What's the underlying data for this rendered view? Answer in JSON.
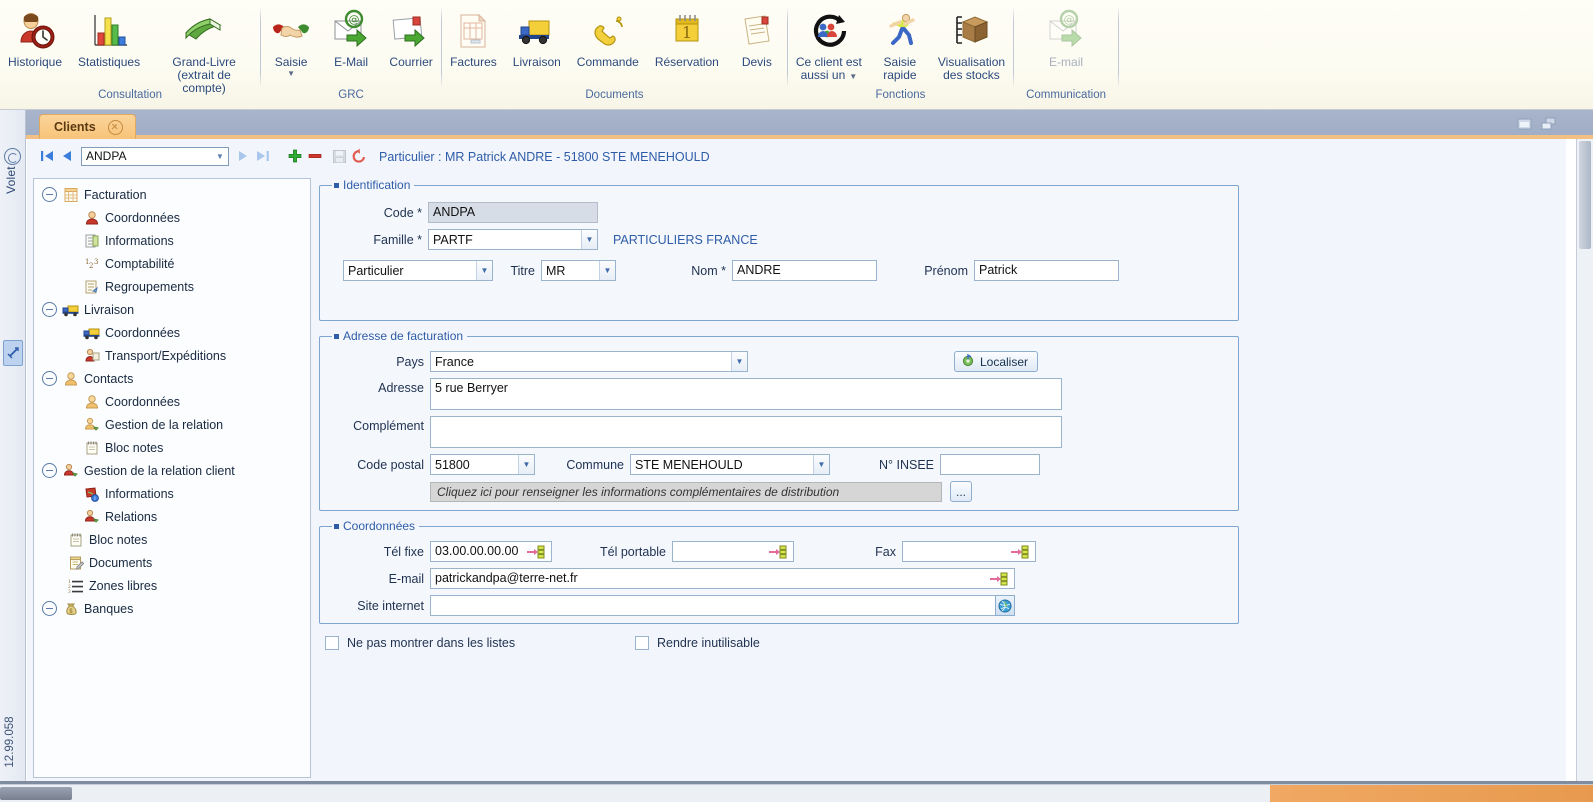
{
  "ribbon": {
    "groups": [
      {
        "name": "Consultation",
        "items": [
          {
            "label": "Historique",
            "icon": "user-history-icon",
            "disabled": false,
            "caret": false
          },
          {
            "label": "Statistiques",
            "icon": "bar-chart-icon",
            "disabled": false,
            "caret": false
          },
          {
            "label": "Grand-Livre\n(extrait de compte)",
            "label_line1": "Grand-Livre",
            "label_line2": "(extrait de compte)",
            "icon": "green-book-icon",
            "disabled": false,
            "caret": false
          }
        ]
      },
      {
        "name": "GRC",
        "items": [
          {
            "label": "Saisie",
            "icon": "handshake-icon",
            "disabled": false,
            "caret": true
          },
          {
            "label": "E-Mail",
            "icon": "email-arrow-icon",
            "disabled": false,
            "caret": false
          },
          {
            "label": "Courrier",
            "icon": "letter-arrow-icon",
            "disabled": false,
            "caret": false
          }
        ]
      },
      {
        "name": "Documents",
        "items": [
          {
            "label": "Factures",
            "icon": "invoice-icon",
            "disabled": false,
            "caret": false
          },
          {
            "label": "Livraison",
            "icon": "truck-icon",
            "disabled": false,
            "caret": false
          },
          {
            "label": "Commande",
            "icon": "phone-handset-icon",
            "disabled": false,
            "caret": false
          },
          {
            "label": "Réservation",
            "icon": "calendar-icon",
            "disabled": false,
            "caret": false
          },
          {
            "label": "Devis",
            "icon": "quote-document-icon",
            "disabled": false,
            "caret": false
          }
        ]
      },
      {
        "name": "Fonctions",
        "items": [
          {
            "label_line1": "Ce client est",
            "label_line2": "aussi un",
            "label": "Ce client est aussi un",
            "icon": "contacts-refresh-icon",
            "disabled": false,
            "caret": true
          },
          {
            "label_line1": "Saisie",
            "label_line2": "rapide",
            "label": "Saisie rapide",
            "icon": "runner-icon",
            "disabled": false,
            "caret": false
          },
          {
            "label_line1": "Visualisation",
            "label_line2": "des stocks",
            "label": "Visualisation des stocks",
            "icon": "box-stock-icon",
            "disabled": false,
            "caret": false
          }
        ]
      },
      {
        "name": "Communication",
        "items": [
          {
            "label": "E-mail",
            "icon": "email-arrow-icon",
            "disabled": true,
            "caret": false
          }
        ]
      }
    ]
  },
  "leftrail": {
    "panel_label": "Volet",
    "version": "12.99.058",
    "circle_icon": "rotate-circle-icon",
    "pin_icon": "pin-panel-icon"
  },
  "tabstrip": {
    "tabs": [
      {
        "label": "Clients",
        "close_icon": "close-circle-icon",
        "active": true
      }
    ],
    "window_buttons": [
      {
        "name": "restore-window-icon"
      },
      {
        "name": "cascade-windows-icon"
      }
    ]
  },
  "navbar": {
    "first_icon": "nav-first-icon",
    "prev_icon": "nav-prev-icon",
    "next_icon": "nav-next-icon",
    "last_icon": "nav-last-icon",
    "add_icon": "add-plus-icon",
    "remove_icon": "remove-minus-icon",
    "save_icon": "save-disk-icon",
    "undo_icon": "undo-arrow-icon",
    "code_value": "ANDPA",
    "headline": "Particulier : MR Patrick ANDRE - 51800 STE MENEHOULD"
  },
  "tree": {
    "nodes": [
      {
        "label": "Facturation",
        "depth": 0,
        "expander": "collapse",
        "icon": "invoice-icon"
      },
      {
        "label": "Coordonnées",
        "depth": 1,
        "expander": "none",
        "icon": "red-person-icon"
      },
      {
        "label": "Informations",
        "depth": 1,
        "expander": "none",
        "icon": "info-list-icon"
      },
      {
        "label": "Comptabilité",
        "depth": 1,
        "expander": "none",
        "icon": "numbers-123-icon"
      },
      {
        "label": "Regroupements",
        "depth": 1,
        "expander": "none",
        "icon": "grouping-icon"
      },
      {
        "label": "Livraison",
        "depth": 0,
        "expander": "collapse",
        "icon": "truck-icon"
      },
      {
        "label": "Coordonnées",
        "depth": 1,
        "expander": "none",
        "icon": "truck-icon"
      },
      {
        "label": "Transport/Expéditions",
        "depth": 1,
        "expander": "none",
        "icon": "delivery-person-icon"
      },
      {
        "label": "Contacts",
        "depth": 0,
        "expander": "collapse",
        "icon": "orange-person-icon"
      },
      {
        "label": "Coordonnées",
        "depth": 1,
        "expander": "none",
        "icon": "orange-person-icon"
      },
      {
        "label": "Gestion de la relation",
        "depth": 1,
        "expander": "none",
        "icon": "relation-orange-icon"
      },
      {
        "label": "Bloc notes",
        "depth": 1,
        "expander": "none",
        "icon": "notepad-icon"
      },
      {
        "label": "Gestion de la relation client",
        "depth": 0,
        "expander": "collapse",
        "icon": "relation-red-icon"
      },
      {
        "label": "Informations",
        "depth": 1,
        "expander": "none",
        "icon": "info-badge-icon"
      },
      {
        "label": "Relations",
        "depth": 1,
        "expander": "none",
        "icon": "relation-red-icon"
      },
      {
        "label": "Bloc notes",
        "depth": 0,
        "expander": "none",
        "icon": "notepad-icon"
      },
      {
        "label": "Documents",
        "depth": 0,
        "expander": "none",
        "icon": "document-pen-icon"
      },
      {
        "label": "Zones libres",
        "depth": 0,
        "expander": "none",
        "icon": "list-numbers-icon"
      },
      {
        "label": "Banques",
        "depth": 0,
        "expander": "collapse",
        "icon": "money-bag-icon"
      }
    ]
  },
  "identification": {
    "legend": "Identification",
    "code_label": "Code *",
    "code_value": "ANDPA",
    "famille_label": "Famille *",
    "famille_value": "PARTF",
    "famille_desc": "PARTICULIERS FRANCE",
    "type_value": "Particulier",
    "titre_label": "Titre",
    "titre_value": "MR",
    "nom_label": "Nom *",
    "nom_value": "ANDRE",
    "prenom_label": "Prénom",
    "prenom_value": "Patrick"
  },
  "adresse": {
    "legend": "Adresse de facturation",
    "pays_label": "Pays",
    "pays_value": "France",
    "localiser_label": "Localiser",
    "localiser_icon": "locate-pin-icon",
    "adresse_label": "Adresse",
    "adresse_value": "5 rue Berryer",
    "complement_label": "Complément",
    "complement_value": "",
    "cp_label": "Code postal",
    "cp_value": "51800",
    "commune_label": "Commune",
    "commune_value": "STE MENEHOULD",
    "insee_label": "N° INSEE",
    "insee_value": "",
    "hint": "Cliquez ici pour renseigner les informations complémentaires de distribution",
    "dots_label": "...",
    "dots_icon": "ellipsis-button-icon"
  },
  "coordonnees": {
    "legend": "Coordonnées",
    "tel_fixe_label": "Tél fixe",
    "tel_fixe_value": "03.00.00.00.00",
    "tel_portable_label": "Tél portable",
    "tel_portable_value": "",
    "fax_label": "Fax",
    "fax_value": "",
    "email_label": "E-mail",
    "email_value": "patrickandpa@terre-net.fr",
    "site_label": "Site internet",
    "site_value": "",
    "field_action_icon": "arrow-to-list-icon",
    "web_icon": "globe-icon"
  },
  "options": {
    "hide_in_lists_label": "Ne pas montrer dans les listes",
    "hide_in_lists_checked": false,
    "disable_label": "Rendre inutilisable",
    "disable_checked": false
  },
  "colors": {
    "ribbon_bg": "#fdfcf2",
    "belt": "#a8b4ca",
    "tab_active": "#f8c379",
    "accent_line": "#f2c083",
    "group_border": "#7ea6d0",
    "legend_text": "#2f5ca8",
    "workspace_bg": "#f2f6fc",
    "readonly_field": "#d7dde7",
    "hint_bar": "#d6d6d6"
  }
}
